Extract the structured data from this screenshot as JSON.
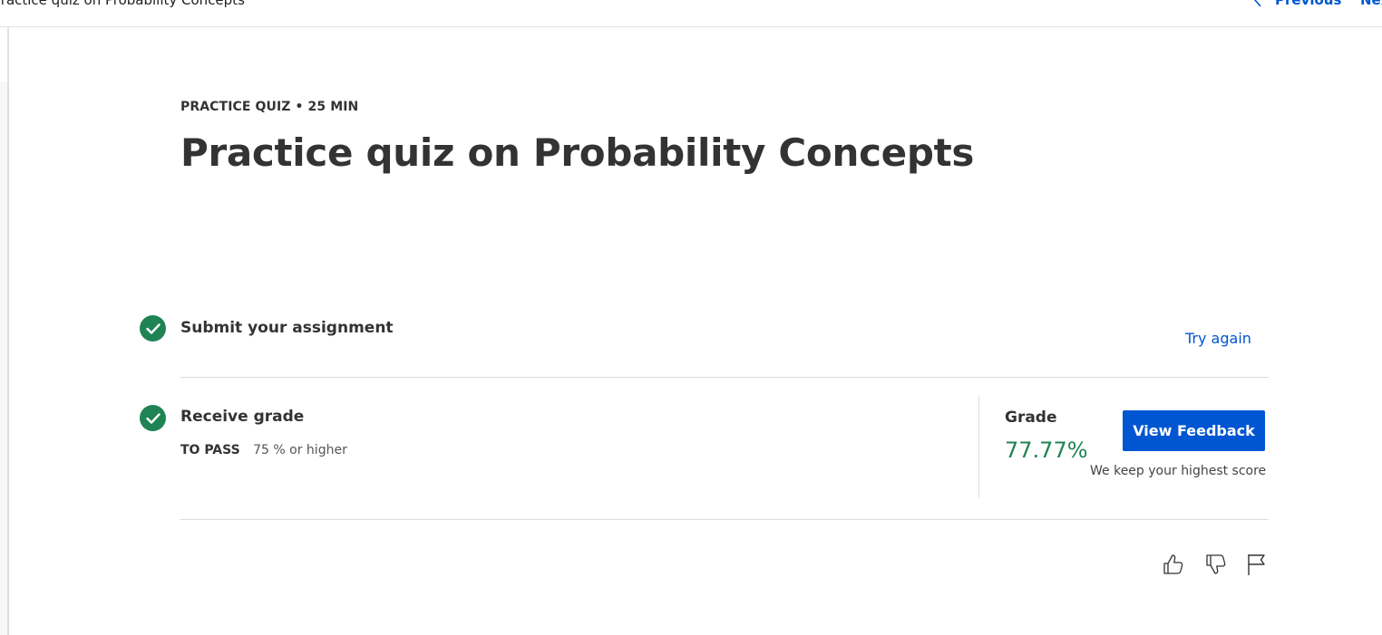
{
  "topbar": {
    "title": "Practice quiz on Probability Concepts",
    "prev_label": "Previous",
    "next_label": "Next"
  },
  "header": {
    "eyebrow": "PRACTICE QUIZ • 25 MIN",
    "title": "Practice quiz on Probability Concepts"
  },
  "steps": {
    "submit": {
      "title": "Submit your assignment",
      "action": "Try again"
    },
    "grade": {
      "title": "Receive grade",
      "pass_label": "TO PASS",
      "pass_value": "75 % or higher"
    }
  },
  "grade_panel": {
    "label": "Grade",
    "value": "77.77%",
    "button": "View Feedback",
    "note": "We keep your highest score"
  },
  "actions": {
    "icons": [
      "thumbs-up-icon",
      "thumbs-down-icon",
      "flag-icon"
    ]
  },
  "colors": {
    "accent": "#0056d2",
    "success": "#1f8354",
    "text": "#333333",
    "divider": "#dcdcdc"
  }
}
